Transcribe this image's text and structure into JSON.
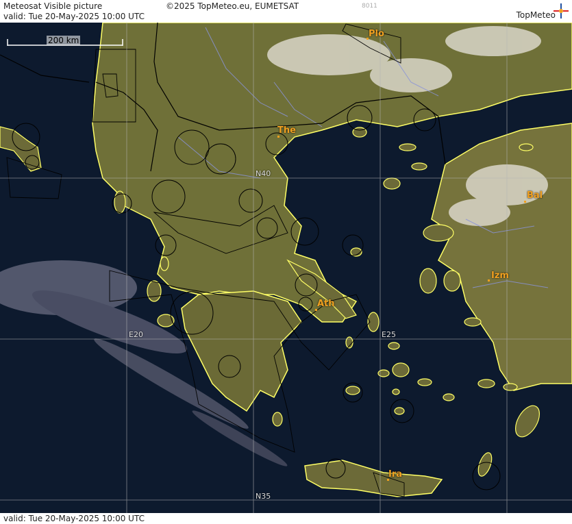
{
  "header": {
    "title": "Meteosat Visible picture",
    "copyright": "©2025 TopMeteo.eu, EUMETSAT",
    "code": "8011",
    "valid": "valid:  Tue  20-May-2025  10:00 UTC",
    "logo_text": "TopMeteo"
  },
  "footer": {
    "valid": "valid:  Tue  20-May-2025  10:00 UTC"
  },
  "scale": {
    "label": "200 km"
  },
  "cities": {
    "plo": "Plo",
    "the": "The",
    "bal": "Bal",
    "izm": "Izm",
    "ath": "Ath",
    "ira": "Ira"
  },
  "grid": {
    "n40": "N40",
    "n35": "N35",
    "e20": "E20",
    "e25": "E25"
  },
  "colors": {
    "sea": "#0d1a2e",
    "land": "#6f7038",
    "coastline": "#ffff66",
    "borders": "#000000",
    "rivers": "#8a93d8",
    "city": "#f0a020"
  }
}
